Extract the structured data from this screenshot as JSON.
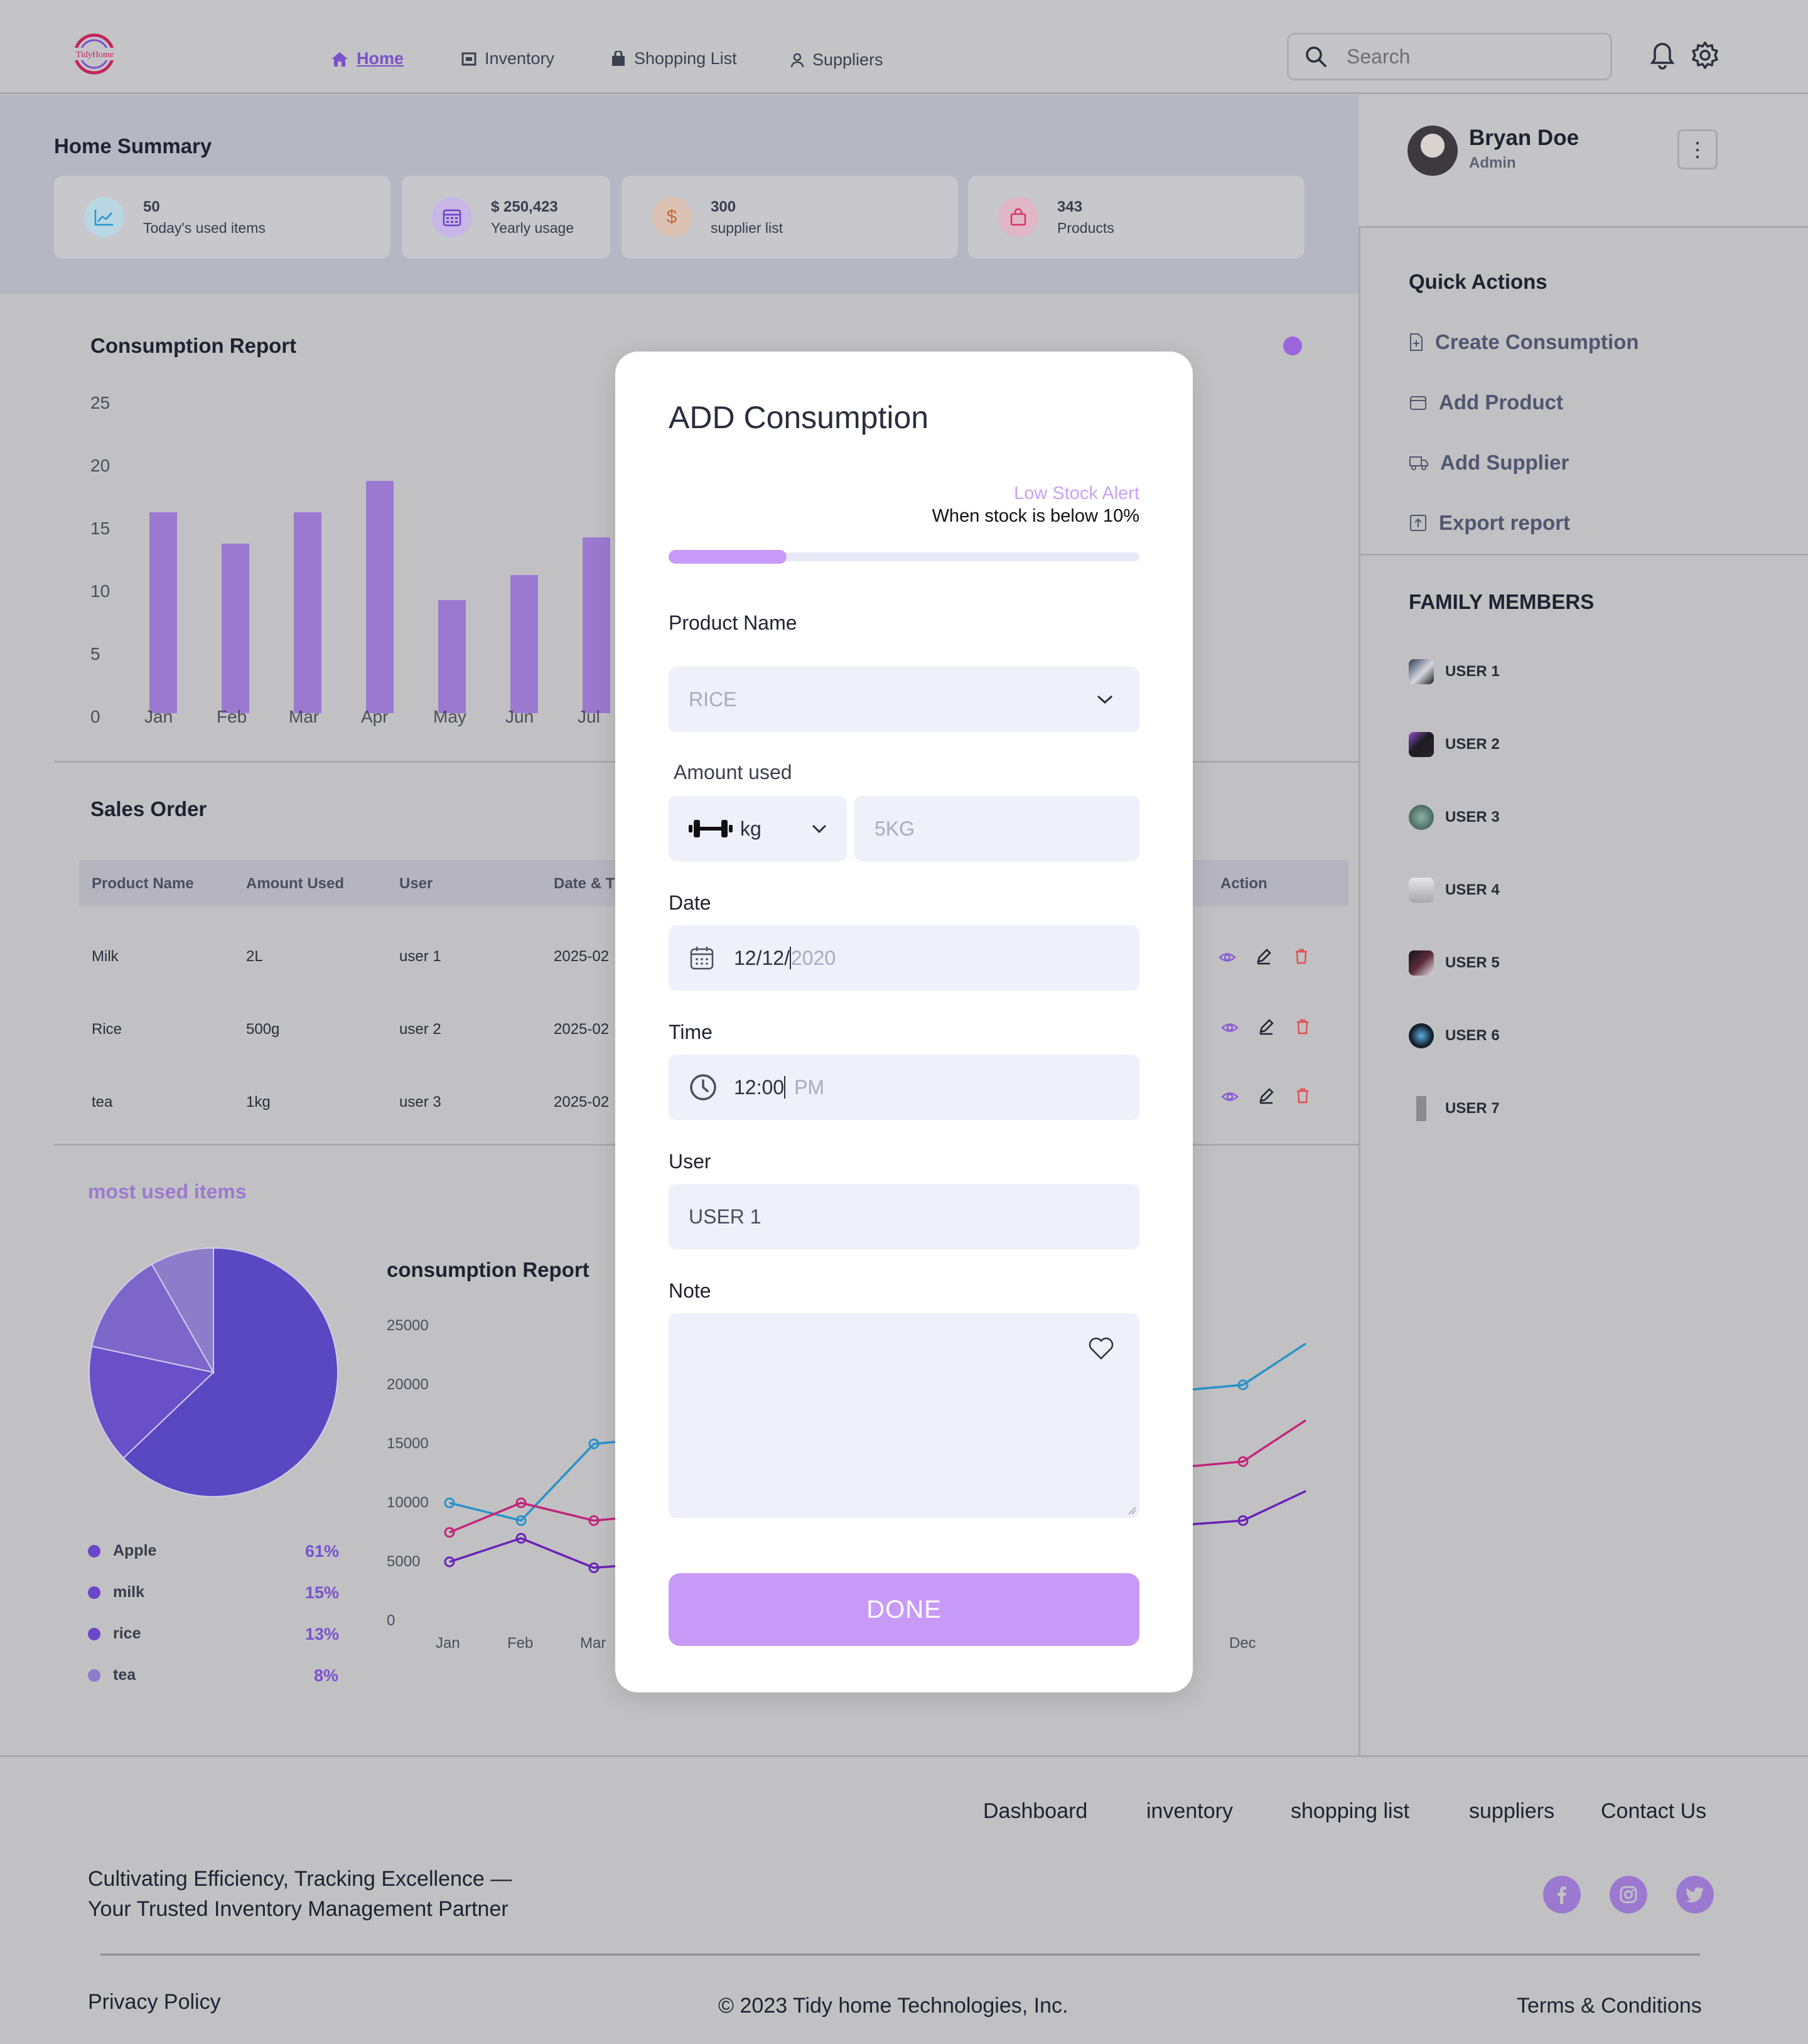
{
  "brand": {
    "logo_text": "TidyHome"
  },
  "nav": [
    {
      "label": "Home",
      "icon": "home-icon",
      "active": true
    },
    {
      "label": "Inventory",
      "icon": "inventory-icon"
    },
    {
      "label": "Shopping List",
      "icon": "shopping-bag-icon"
    },
    {
      "label": "Suppliers",
      "icon": "user-icon"
    }
  ],
  "search": {
    "placeholder": "Search"
  },
  "summary": {
    "title": "Home Summary",
    "cards": [
      {
        "value": "50",
        "label": "Today's used items",
        "icon": "trend-icon"
      },
      {
        "value": "$ 250,423",
        "label": "Yearly usage",
        "icon": "calendar-icon"
      },
      {
        "value": "300",
        "label": "supplier list",
        "icon": "dollar-icon"
      },
      {
        "value": "343",
        "label": "Products",
        "icon": "bag-icon"
      }
    ]
  },
  "profile": {
    "name": "Bryan Doe",
    "role": "Admin"
  },
  "quick_actions": {
    "title": "Quick Actions",
    "items": [
      "Create Consumption",
      "Add Product",
      "Add Supplier",
      "Export report"
    ]
  },
  "family": {
    "title": "FAMILY MEMBERS",
    "members": [
      "USER 1",
      "USER 2",
      "USER 3",
      "USER 4",
      "USER 5",
      "USER 6",
      "USER 7"
    ]
  },
  "consumption_report": {
    "title": "Consumption Report"
  },
  "sales_order": {
    "title": "Sales Order",
    "headers": [
      "Product Name",
      "Amount Used",
      "User",
      "Date & T",
      "Action"
    ],
    "rows": [
      [
        "Milk",
        "2L",
        "user 1",
        "2025-02"
      ],
      [
        "Rice",
        "500g",
        "user 2",
        "2025-02"
      ],
      [
        "tea",
        "1kg",
        "user 3",
        "2025-02"
      ]
    ]
  },
  "most_used": {
    "title": "most used items",
    "legend": [
      {
        "name": "Apple",
        "pct": "61%"
      },
      {
        "name": "milk",
        "pct": "15%"
      },
      {
        "name": "rice",
        "pct": "13%"
      },
      {
        "name": "tea",
        "pct": "8%"
      }
    ]
  },
  "line_report": {
    "title": "consumption Report"
  },
  "chart_data": [
    {
      "type": "bar",
      "title": "Consumption Report",
      "categories": [
        "Jan",
        "Feb",
        "Mar",
        "Apr",
        "May",
        "Jun",
        "Jul"
      ],
      "values": [
        16,
        13.5,
        16,
        18.5,
        9,
        11,
        14
      ],
      "yticks": [
        0,
        5,
        10,
        15,
        20,
        25
      ],
      "ylim": [
        0,
        25
      ],
      "color": "#9b79d0"
    },
    {
      "type": "pie",
      "title": "most used items",
      "labels": [
        "Apple",
        "milk",
        "rice",
        "tea"
      ],
      "values": [
        61,
        15,
        13,
        8
      ],
      "colors": [
        "#5a47c2",
        "#6a50c8",
        "#7c66c9",
        "#8c7cc9"
      ]
    },
    {
      "type": "line",
      "title": "consumption Report",
      "x": [
        "Jan",
        "Feb",
        "Mar",
        "Dec"
      ],
      "yticks": [
        0,
        5000,
        10000,
        15000,
        20000,
        25000
      ],
      "ylim": [
        0,
        25000
      ],
      "series": [
        {
          "color": "#2a93c9",
          "values": [
            10000,
            8500,
            15000,
            20000
          ]
        },
        {
          "color": "#c2257a",
          "values": [
            7500,
            10000,
            8500,
            13500
          ]
        },
        {
          "color": "#6a22b8",
          "values": [
            5000,
            7000,
            4500,
            8500
          ]
        }
      ]
    }
  ],
  "modal": {
    "title": "ADD Consumption",
    "alert_title": "Low Stock Alert",
    "alert_text": "When stock is below 10%",
    "alert_progress": 0.25,
    "product_label": "Product Name",
    "product_value": "RICE",
    "amount_label": "Amount used",
    "unit": "kg",
    "amount_placeholder": "5KG",
    "date_label": "Date",
    "date_value": "12/12/",
    "date_placeholder": "2020",
    "time_label": "Time",
    "time_value": "12:00",
    "time_placeholder": "PM",
    "user_label": "User",
    "user_value": "USER 1",
    "note_label": "Note",
    "done_label": "DONE"
  },
  "footer": {
    "links": [
      "Dashboard",
      "inventory",
      "shopping list",
      "suppliers",
      "Contact Us"
    ],
    "tagline_1": "Cultivating Efficiency, Tracking Excellence —",
    "tagline_2": "Your Trusted Inventory Management Partner",
    "privacy": "Privacy Policy",
    "copyright": "© 2023 Tidy home Technologies, Inc.",
    "terms": "Terms & Conditions"
  }
}
